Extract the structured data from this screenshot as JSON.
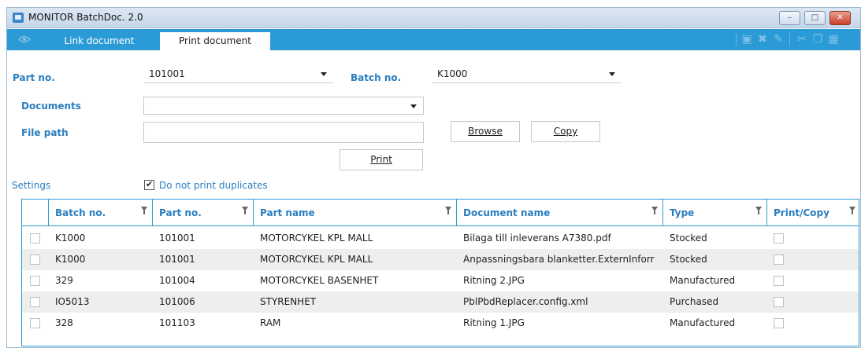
{
  "window": {
    "title": "MONITOR BatchDoc. 2.0",
    "min": "–",
    "max": "□",
    "close": "✕"
  },
  "tabs": [
    {
      "label": "Link document"
    },
    {
      "label": "Print document"
    }
  ],
  "toolbar": {
    "icons": [
      "save-icon",
      "delete-icon",
      "eraser-icon",
      "cut-icon",
      "copy-icon",
      "paste-icon"
    ]
  },
  "form": {
    "part_no_label": "Part no.",
    "part_no_value": "101001",
    "batch_no_label": "Batch no.",
    "batch_no_value": "K1000",
    "documents_label": "Documents",
    "documents_value": "",
    "file_path_label": "File path",
    "file_path_value": "",
    "browse_label": "Browse",
    "copy_label": "Copy",
    "print_label": "Print",
    "settings_label": "Settings",
    "no_duplicates_label": "Do not print duplicates",
    "no_duplicates_checked": true
  },
  "grid": {
    "columns": [
      "Batch no.",
      "Part no.",
      "Part name",
      "Document name",
      "Type",
      "Print/Copy"
    ],
    "rows": [
      [
        "K1000",
        "101001",
        "MOTORCYKEL KPL MALL",
        "Bilaga till inleverans A7380.pdf",
        "Stocked"
      ],
      [
        "K1000",
        "101001",
        "MOTORCYKEL KPL MALL",
        "Anpassningsbara blanketter.ExternInforr",
        "Stocked"
      ],
      [
        "329",
        "101004",
        "MOTORCYKEL BASENHET",
        "Ritning 2.JPG",
        "Manufactured"
      ],
      [
        "IO5013",
        "101006",
        "STYRENHET",
        "PblPbdReplacer.config.xml",
        "Purchased"
      ],
      [
        "328",
        "101103",
        "RAM",
        "Ritning 1.JPG",
        "Manufactured"
      ]
    ]
  },
  "colors": {
    "accent": "#2a9bd7",
    "label": "#2a7ec0",
    "alt_row": "#eeeeee"
  }
}
